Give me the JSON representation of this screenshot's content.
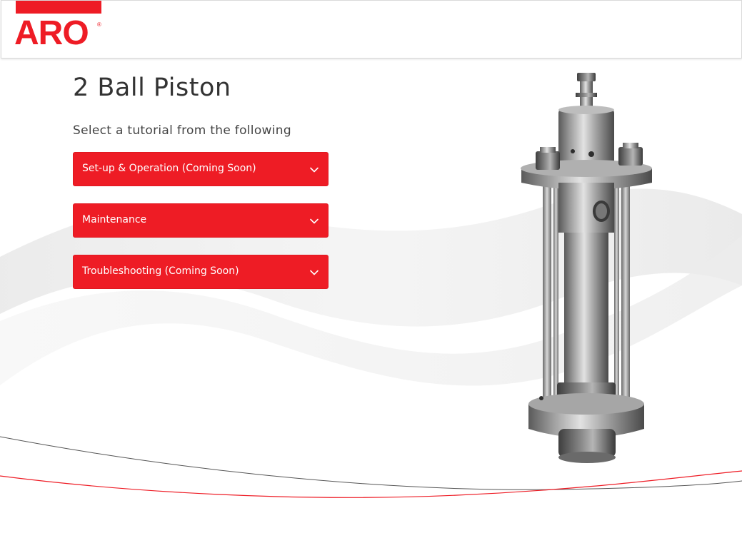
{
  "brand": {
    "logo_text": "ARO",
    "logo_mark": "®",
    "accent": "#ee1c25"
  },
  "main": {
    "title": "2 Ball Piston",
    "subtitle": "Select a tutorial from the following",
    "accordion": [
      {
        "label": "Set-up & Operation (Coming Soon)",
        "icon": "chevron-down-icon"
      },
      {
        "label": "Maintenance",
        "icon": "chevron-down-icon"
      },
      {
        "label": "Troubleshooting (Coming Soon)",
        "icon": "chevron-down-icon"
      }
    ]
  },
  "product_image": {
    "subject": "2 ball piston pump lower assembly"
  },
  "colors": {
    "background": "#ffffff",
    "button": "#ee1c25",
    "button_text": "#ffffff",
    "title": "#333333",
    "line_gray": "#555555",
    "line_red": "#ee1c25"
  }
}
